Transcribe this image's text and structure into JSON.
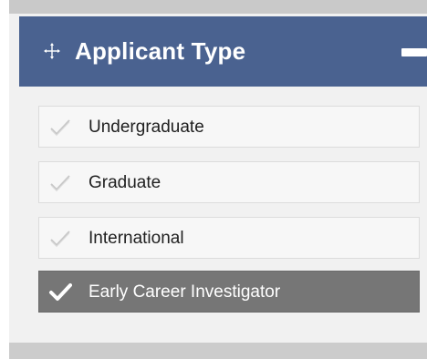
{
  "panel": {
    "title": "Applicant Type",
    "colors": {
      "header_bg": "#4a6290",
      "selected_bg": "#767676",
      "item_bg": "#f7f7f7"
    },
    "header_icons": {
      "left": "move-icon",
      "right": "collapse-icon"
    },
    "items": [
      {
        "label": "Undergraduate",
        "checked": false,
        "icon": "check-icon"
      },
      {
        "label": "Graduate",
        "checked": false,
        "icon": "check-icon"
      },
      {
        "label": "International",
        "checked": false,
        "icon": "check-icon"
      },
      {
        "label": "Early Career Investigator",
        "checked": true,
        "icon": "check-icon"
      }
    ]
  }
}
